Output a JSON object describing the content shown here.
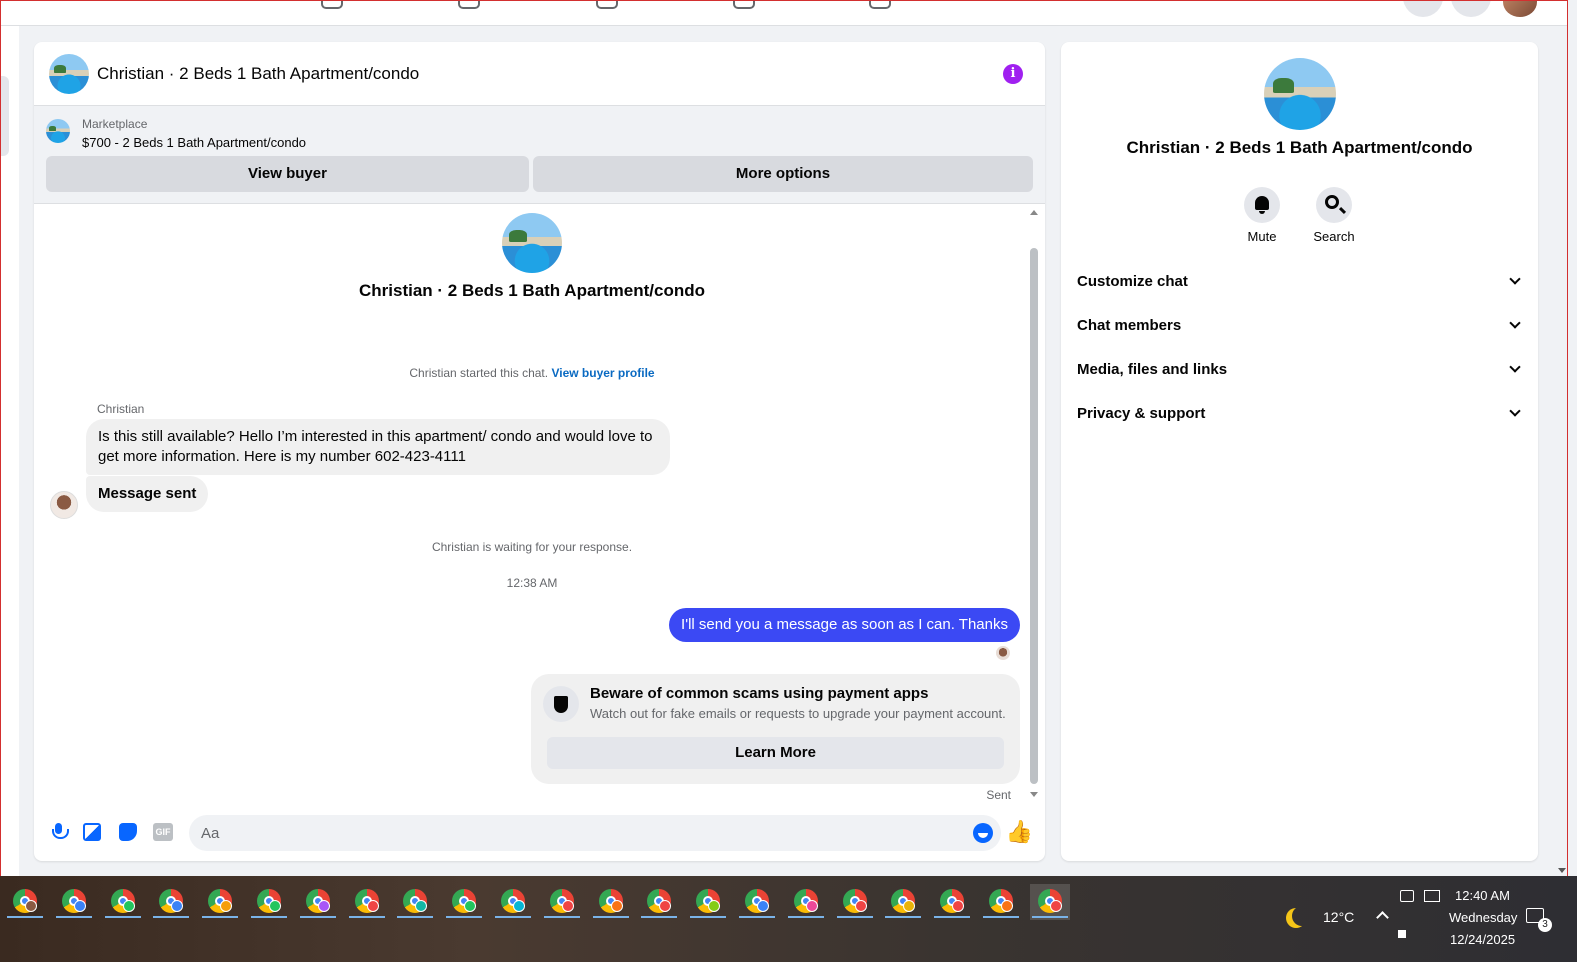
{
  "chat": {
    "title": "Christian · 2 Beds 1 Bath Apartment/condo",
    "marketplace_label": "Marketplace",
    "listing": "$700 - 2 Beds 1 Bath Apartment/condo",
    "view_buyer": "View buyer",
    "more_options": "More options"
  },
  "conversation": {
    "intro_title": "Christian · 2 Beds 1 Bath Apartment/condo",
    "started_text": "Christian started this chat.",
    "view_buyer_profile": "View buyer profile",
    "sender_name": "Christian",
    "message_1": "Is this still available? Hello I’m interested in this apartment/ condo and would love to get more information. Here is my number 602-423-4111",
    "message_2": "Message sent",
    "waiting": "Christian is waiting for your response.",
    "timestamp": "12:38 AM",
    "reply": "I'll send you a message as soon as I can. Thanks",
    "scam_title": "Beware of common scams using payment apps",
    "scam_body": "Watch out for fake emails or requests to upgrade your payment account.",
    "learn_more": "Learn More",
    "status": "Sent"
  },
  "composer": {
    "placeholder": "Aa",
    "gif_label": "GIF"
  },
  "panel": {
    "title": "Christian · 2 Beds 1 Bath Apartment/condo",
    "mute": "Mute",
    "search": "Search",
    "sections": [
      "Customize chat",
      "Chat members",
      "Media, files and links",
      "Privacy & support"
    ]
  },
  "taskbar": {
    "temperature": "12°C",
    "time": "12:40 AM",
    "day": "Wednesday",
    "date": "12/24/2025",
    "notification_count": "3"
  },
  "icons": {
    "info": "info-icon",
    "mic": "microphone-icon",
    "photo": "photo-icon",
    "sticker": "sticker-icon",
    "gif": "gif-icon",
    "emoji": "emoji-icon",
    "like": "thumbs-up-icon",
    "mute": "bell-icon",
    "search": "search-icon",
    "scam": "shield-icon"
  },
  "colors": {
    "accent": "#0866ff",
    "outgoing_bubble": "#3b49f4",
    "info": "#a020f0",
    "link": "#0a6ac2"
  }
}
